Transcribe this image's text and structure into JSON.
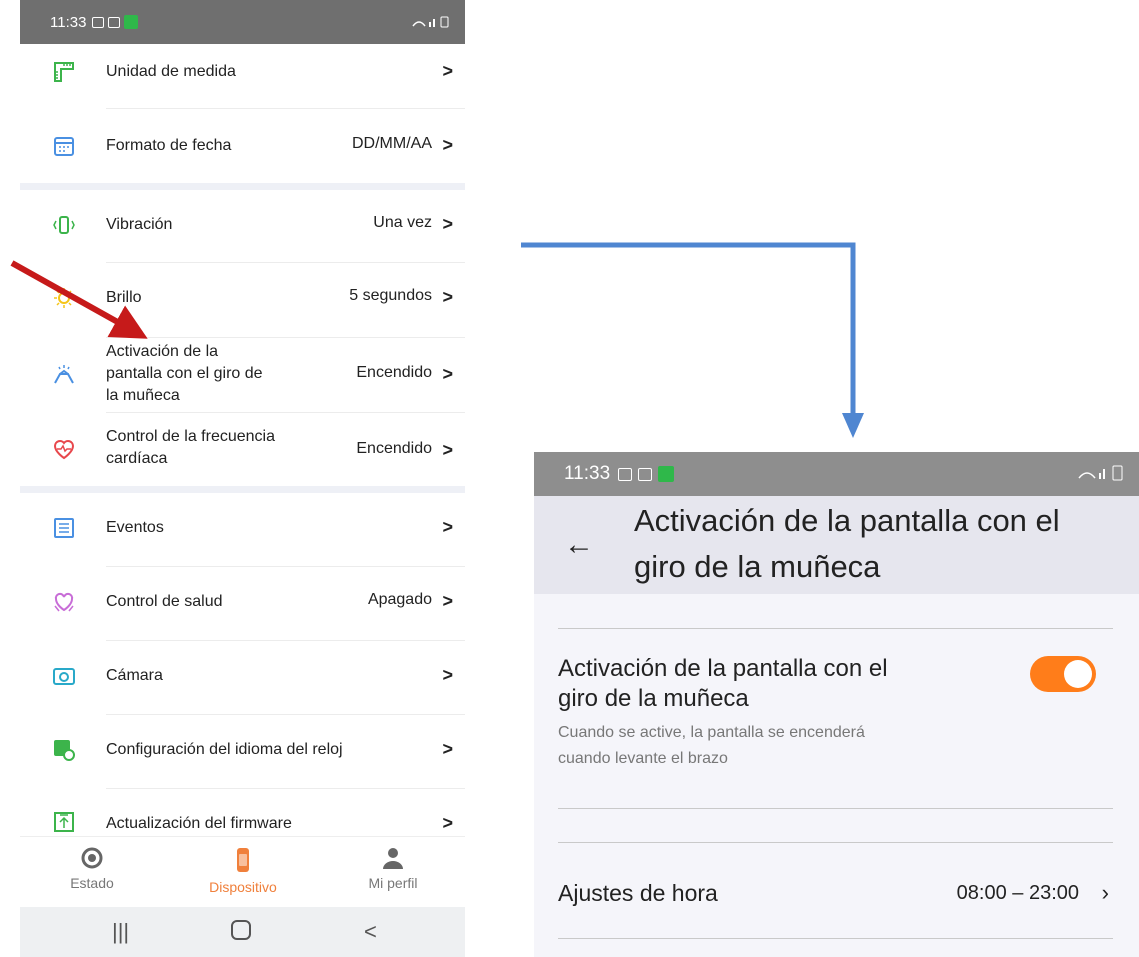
{
  "left": {
    "status_time": "11:33",
    "items": [
      {
        "label": "Unidad de medida",
        "value": "",
        "icon": "ruler-icon",
        "color": "#3cb44b"
      },
      {
        "label": "Formato de fecha",
        "value": "DD/MM/AA",
        "icon": "calendar-icon",
        "color": "#4a90e2"
      },
      {
        "label": "Vibración",
        "value": "Una vez",
        "icon": "vibration-icon",
        "color": "#3cb44b"
      },
      {
        "label": "Brillo",
        "value": "5 segundos",
        "icon": "sun-icon",
        "color": "#f5c518"
      },
      {
        "label": "Activación de la pantalla con el giro de la muñeca",
        "value": "Encendido",
        "icon": "wrist-icon",
        "color": "#4a90e2"
      },
      {
        "label": "Control de la frecuencia cardíaca",
        "value": "Encendido",
        "icon": "heart-rate-icon",
        "color": "#e8474c"
      },
      {
        "label": "Eventos",
        "value": "",
        "icon": "events-icon",
        "color": "#4a90e2"
      },
      {
        "label": "Control de salud",
        "value": "Apagado",
        "icon": "health-icon",
        "color": "#c86dd7"
      },
      {
        "label": "Cámara",
        "value": "",
        "icon": "camera-icon",
        "color": "#29a9c9"
      },
      {
        "label": "Configuración del idioma del reloj",
        "value": "",
        "icon": "language-icon",
        "color": "#3cb44b"
      },
      {
        "label": "Actualización del firmware",
        "value": "",
        "icon": "firmware-icon",
        "color": "#3cb44b"
      }
    ],
    "activation_lines": [
      "Activación de la",
      "pantalla con el giro de",
      "la muñeca"
    ],
    "heart_lines": [
      "Control de la frecuencia",
      "cardíaca"
    ],
    "nav": {
      "status": "Estado",
      "device": "Dispositivo",
      "profile": "Mi perfil"
    },
    "chevron": ">"
  },
  "right": {
    "status_time": "11:33",
    "title_lines": [
      "Activación de la pantalla con el",
      "giro de la muñeca"
    ],
    "toggle_lines": [
      "Activación de la pantalla con el",
      "giro de la muñeca"
    ],
    "toggle_sub_lines": [
      "Cuando se active, la pantalla se encenderá",
      "cuando levante el brazo"
    ],
    "toggle_on": true,
    "time_label": "Ajustes de hora",
    "time_value": "08:00 – 23:00",
    "chevron": "›",
    "back": "←"
  },
  "colors": {
    "accent": "#ff7d1a",
    "arrow_red": "#c61a1a",
    "arrow_blue": "#4f86d1",
    "nav_active": "#f0803c"
  }
}
